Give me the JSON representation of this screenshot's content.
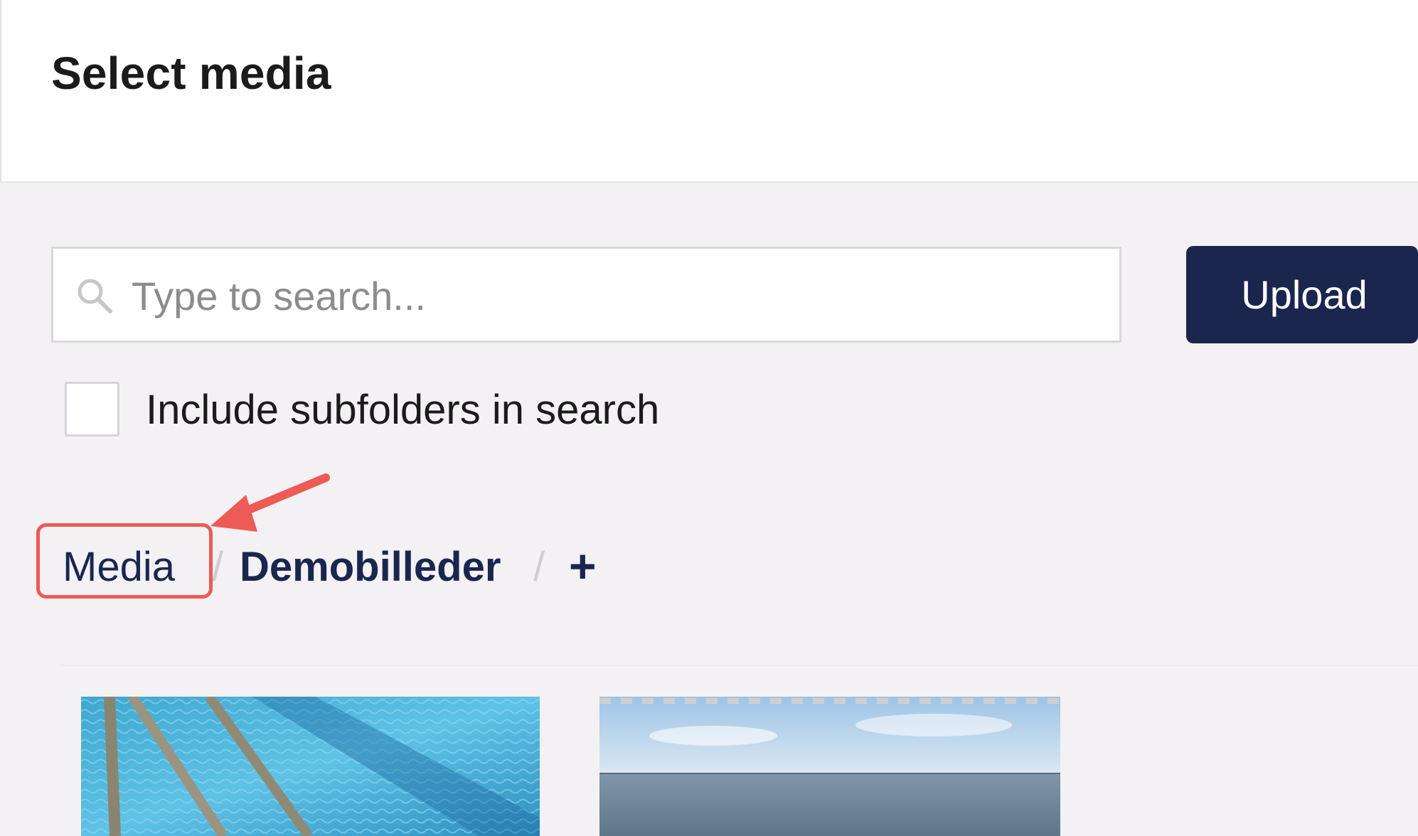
{
  "header": {
    "title": "Select media"
  },
  "search": {
    "placeholder": "Type to search..."
  },
  "toolbar": {
    "upload_label": "Upload"
  },
  "options": {
    "include_subfolders_label": "Include subfolders in search",
    "include_subfolders_checked": false
  },
  "breadcrumb": {
    "items": [
      {
        "label": "Media"
      },
      {
        "label": "Demobilleder"
      }
    ],
    "separator": "/",
    "add_label": "+"
  },
  "colors": {
    "accent": "#1b264f",
    "highlight": "#ee5a55",
    "background": "#f3f1f3"
  },
  "icons": {
    "search": "search-icon",
    "add": "plus-icon"
  },
  "media_grid": {
    "items": [
      {
        "kind": "image",
        "subject": "swimming pool ladder"
      },
      {
        "kind": "image",
        "subject": "sea horizon"
      }
    ]
  }
}
